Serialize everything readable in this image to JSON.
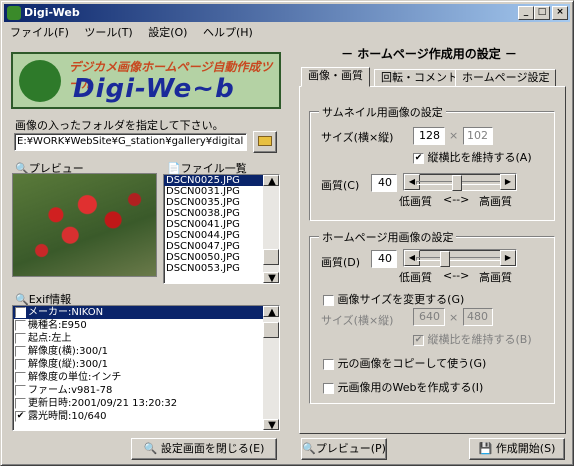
{
  "window": {
    "title": "Digi-Web",
    "min": "_",
    "max": "□",
    "close": "×"
  },
  "menu": [
    "ファイル(F)",
    "ツール(T)",
    "設定(O)",
    "ヘルプ(H)"
  ],
  "logo": {
    "tagline": "デジカメ画像ホームページ自動作成ツール",
    "name": "Digi-We~b"
  },
  "folder": {
    "label": "画像の入ったフォルダを指定して下さい。",
    "path": "E:¥WORK¥WebSite¥G_station¥gallery¥digital"
  },
  "preview": {
    "label": "プレビュー"
  },
  "files": {
    "label": "ファイル一覧",
    "items": [
      "DSCN0025.JPG",
      "DSCN0031.JPG",
      "DSCN0035.JPG",
      "DSCN0038.JPG",
      "DSCN0041.JPG",
      "DSCN0044.JPG",
      "DSCN0047.JPG",
      "DSCN0050.JPG",
      "DSCN0053.JPG"
    ]
  },
  "exif": {
    "label": "Exif情報",
    "items": [
      {
        "text": "メーカー:NIKON",
        "checked": false,
        "selected": true
      },
      {
        "text": "機種名:E950",
        "checked": false
      },
      {
        "text": "起点:左上",
        "checked": false
      },
      {
        "text": "解像度(横):300/1",
        "checked": false
      },
      {
        "text": "解像度(縦):300/1",
        "checked": false
      },
      {
        "text": "解像度の単位:インチ",
        "checked": false
      },
      {
        "text": "ファーム:v981-78",
        "checked": false
      },
      {
        "text": "更新日時:2001/09/21 13:20:32",
        "checked": false
      },
      {
        "text": "露光時間:10/640",
        "checked": true
      }
    ]
  },
  "close_settings_label": "設定画面を閉じる(E)",
  "settings": {
    "title": "－ ホームページ作成用の設定 －",
    "tabs": [
      "画像・画質",
      "回転・コメント",
      "ホームページ設定"
    ],
    "thumb": {
      "group": "サムネイル用画像の設定",
      "size_label": "サイズ(横×縦)",
      "w": "128",
      "x": "×",
      "h": "102",
      "keep_ratio": "縦横比を維持する(A)",
      "quality_label": "画質(C)",
      "quality": "40",
      "low": "低画質",
      "arrow": "<-->",
      "high": "高画質",
      "quality_fraction": 0.45
    },
    "hp": {
      "group": "ホームページ用画像の設定",
      "quality_label": "画質(D)",
      "quality": "40",
      "low": "低画質",
      "arrow": "<-->",
      "high": "高画質",
      "quality_fraction": 0.3,
      "change_size": "画像サイズを変更する(G)",
      "size_label": "サイズ(横×縦)",
      "w": "640",
      "x": "×",
      "h": "480",
      "keep_ratio": "縦横比を維持する(B)",
      "copy_original": "元の画像をコピーして使う(G)",
      "make_web": "元画像用のWebを作成する(I)"
    },
    "preview_btn": "プレビュー(P)",
    "start_btn": "作成開始(S)"
  }
}
